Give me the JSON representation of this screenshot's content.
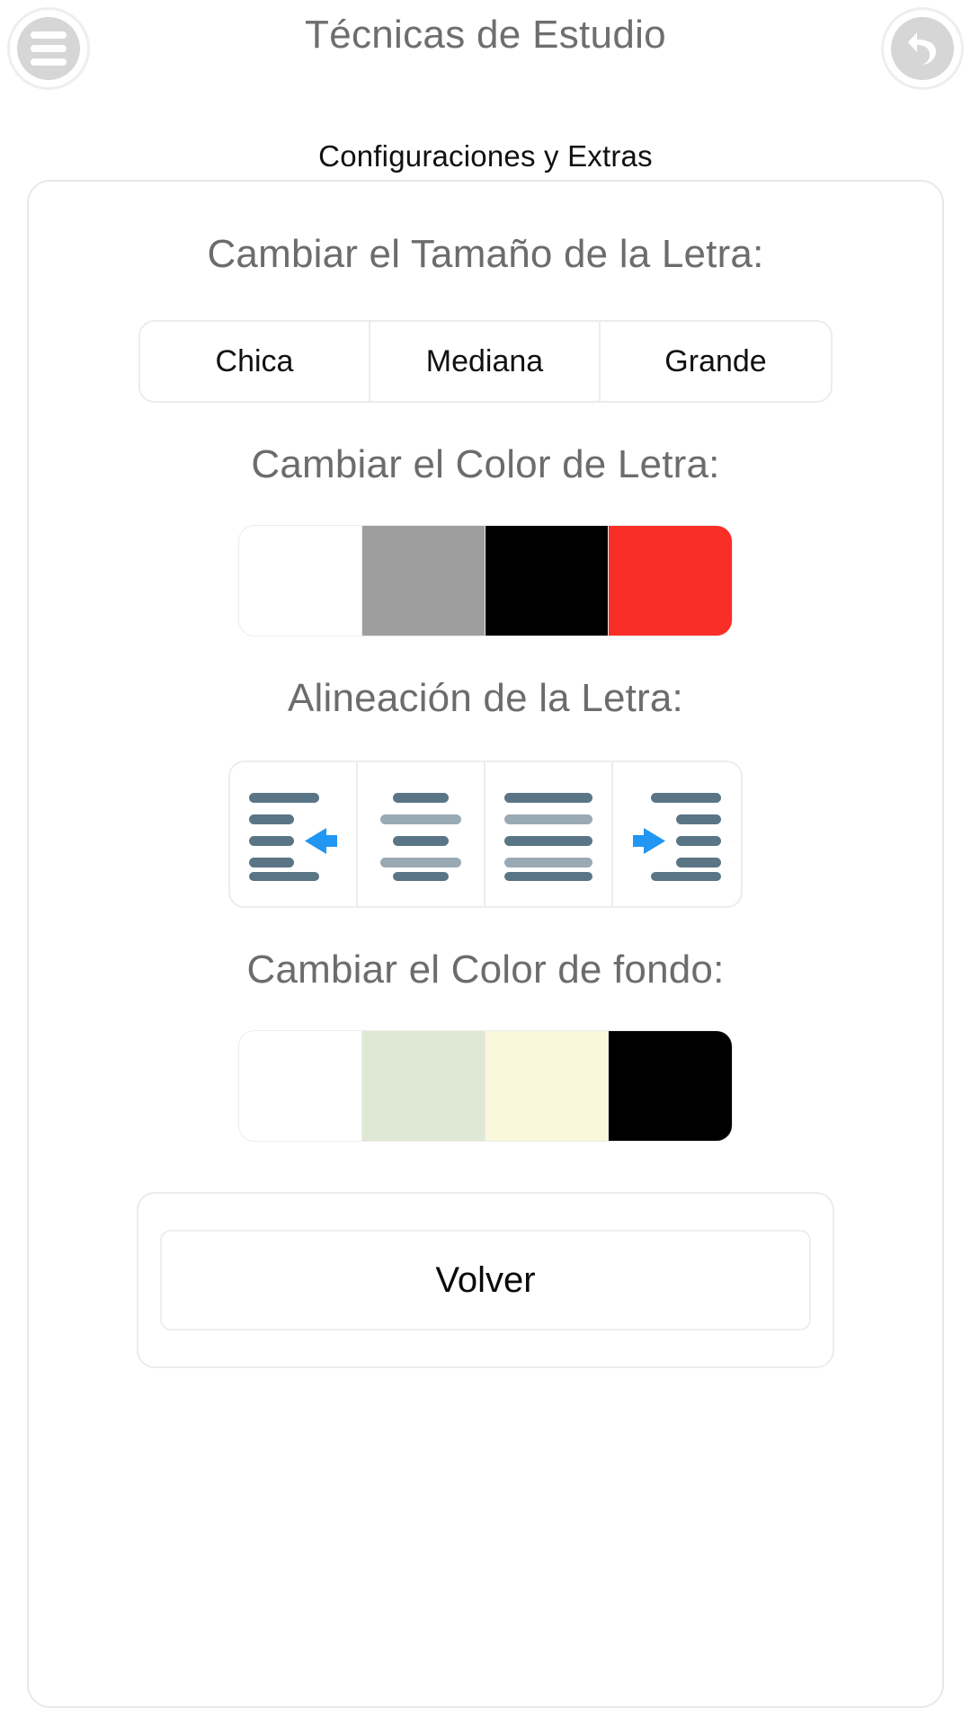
{
  "header": {
    "title": "Técnicas de Estudio",
    "subtitle": "Configuraciones y Extras",
    "menu_icon": "hamburger-menu-icon",
    "back_icon": "undo-back-arrow-icon"
  },
  "sections": {
    "font_size": {
      "title": "Cambiar el Tamaño de la Letra:",
      "options": [
        {
          "label": "Chica"
        },
        {
          "label": "Mediana"
        },
        {
          "label": "Grande"
        }
      ]
    },
    "font_color": {
      "title": "Cambiar el Color de Letra:",
      "swatches": [
        {
          "name": "white",
          "color": "#ffffff"
        },
        {
          "name": "gray",
          "color": "#9e9e9e"
        },
        {
          "name": "black",
          "color": "#000000"
        },
        {
          "name": "red",
          "color": "#f92e27"
        }
      ]
    },
    "alignment": {
      "title": "Alineación de la Letra:",
      "options": [
        {
          "name": "align-outdent-left",
          "icon": "format-indent-decrease-icon"
        },
        {
          "name": "align-center",
          "icon": "format-align-center-icon"
        },
        {
          "name": "align-justify",
          "icon": "format-align-justify-icon"
        },
        {
          "name": "align-indent-right",
          "icon": "format-indent-increase-icon"
        }
      ],
      "bar_colors": {
        "dark": "#5a7586",
        "light": "#9aaab4",
        "accent": "#2196f3"
      }
    },
    "background_color": {
      "title": "Cambiar el Color de fondo:",
      "swatches": [
        {
          "name": "white",
          "color": "#ffffff"
        },
        {
          "name": "light-green",
          "color": "#dfe8d4"
        },
        {
          "name": "light-cream",
          "color": "#faf8db"
        },
        {
          "name": "black",
          "color": "#000000"
        }
      ]
    }
  },
  "footer": {
    "back_label": "Volver"
  },
  "colors": {
    "page_background": "#ffffff",
    "card_border": "#e8e8e8",
    "heading_text": "#6c6c6c",
    "body_text": "#101010",
    "accent_blue": "#2196f3"
  }
}
